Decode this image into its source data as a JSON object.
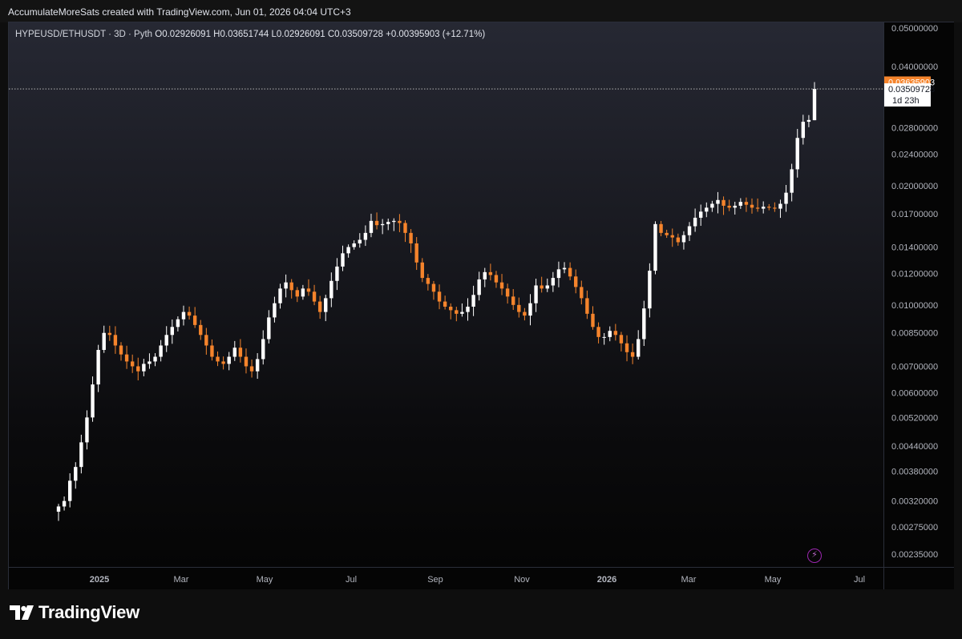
{
  "header": {
    "credit": "AccumulateMoreSats created with TradingView.com, Jun 01, 2026 04:04 UTC+3"
  },
  "legend": {
    "symbol": "HYPEUSD/ETHUSDT · 3D · Pyth",
    "open_label": "O",
    "open": "0.02926091",
    "high_label": "H",
    "high": "0.03651744",
    "low_label": "L",
    "low": "0.02926091",
    "close_label": "C",
    "close": "0.03509728",
    "change": "+0.00395903 (+12.71%)"
  },
  "price_tags": {
    "high_tag": "0.03635903",
    "last_price": "0.03509728",
    "countdown": "1d 23h"
  },
  "branding": {
    "logo_text": "TradingView"
  },
  "colors": {
    "up": "#ffffff",
    "down": "#f5842c",
    "high_tag_bg": "#f5842c",
    "last_tag_bg": "#ffffff",
    "accent_bolt": "#9c27b0"
  },
  "chart_data": {
    "type": "candlestick",
    "title": "HYPEUSD/ETHUSDT · 3D · Pyth",
    "x_ticks": [
      "2025",
      "Mar",
      "May",
      "Jul",
      "Sep",
      "Nov",
      "2026",
      "Mar",
      "May",
      "Jul"
    ],
    "y_ticks": [
      "0.05000000",
      "0.04000000",
      "0.02800000",
      "0.02400000",
      "0.02000000",
      "0.01700000",
      "0.01400000",
      "0.01200000",
      "0.01000000",
      "0.00850000",
      "0.00700000",
      "0.00600000",
      "0.00520000",
      "0.00440000",
      "0.00380000",
      "0.00320000",
      "0.00275000",
      "0.00235000"
    ],
    "close_path": [
      0.0031,
      0.0032,
      0.0036,
      0.0039,
      0.0045,
      0.0052,
      0.0063,
      0.0077,
      0.0085,
      0.0084,
      0.0079,
      0.0075,
      0.0072,
      0.007,
      0.0068,
      0.0071,
      0.0072,
      0.0074,
      0.0079,
      0.0084,
      0.0088,
      0.0092,
      0.0096,
      0.0094,
      0.0089,
      0.0084,
      0.0079,
      0.0074,
      0.0072,
      0.0071,
      0.0074,
      0.0078,
      0.0074,
      0.007,
      0.0068,
      0.0073,
      0.0082,
      0.0093,
      0.0101,
      0.011,
      0.0114,
      0.0109,
      0.0105,
      0.011,
      0.0108,
      0.0102,
      0.0096,
      0.0104,
      0.0115,
      0.0125,
      0.0135,
      0.014,
      0.0143,
      0.0146,
      0.0152,
      0.0163,
      0.0159,
      0.016,
      0.0162,
      0.0163,
      0.0161,
      0.0152,
      0.0143,
      0.0128,
      0.0117,
      0.0113,
      0.0108,
      0.0102,
      0.0099,
      0.0097,
      0.0095,
      0.0096,
      0.0099,
      0.0106,
      0.0116,
      0.0121,
      0.0119,
      0.0114,
      0.011,
      0.0105,
      0.01,
      0.0096,
      0.0094,
      0.0101,
      0.0112,
      0.011,
      0.0112,
      0.0117,
      0.0123,
      0.0124,
      0.0118,
      0.0111,
      0.0104,
      0.0095,
      0.0088,
      0.0083,
      0.0083,
      0.0086,
      0.0084,
      0.008,
      0.0076,
      0.0074,
      0.0082,
      0.0098,
      0.0122,
      0.016,
      0.0152,
      0.015,
      0.0148,
      0.0144,
      0.015,
      0.0158,
      0.0166,
      0.0172,
      0.0176,
      0.018,
      0.0184,
      0.0178,
      0.0176,
      0.0178,
      0.0182,
      0.0179,
      0.0176,
      0.0175,
      0.0177,
      0.0176,
      0.0175,
      0.018,
      0.0192,
      0.022,
      0.0264,
      0.029,
      0.0293,
      0.0351
    ],
    "last_candle": {
      "open": 0.02926091,
      "high": 0.03651744,
      "low": 0.02926091,
      "close": 0.03509728
    },
    "ylim": [
      0.00225,
      0.0515
    ],
    "y_scale": "log",
    "grid": false
  }
}
